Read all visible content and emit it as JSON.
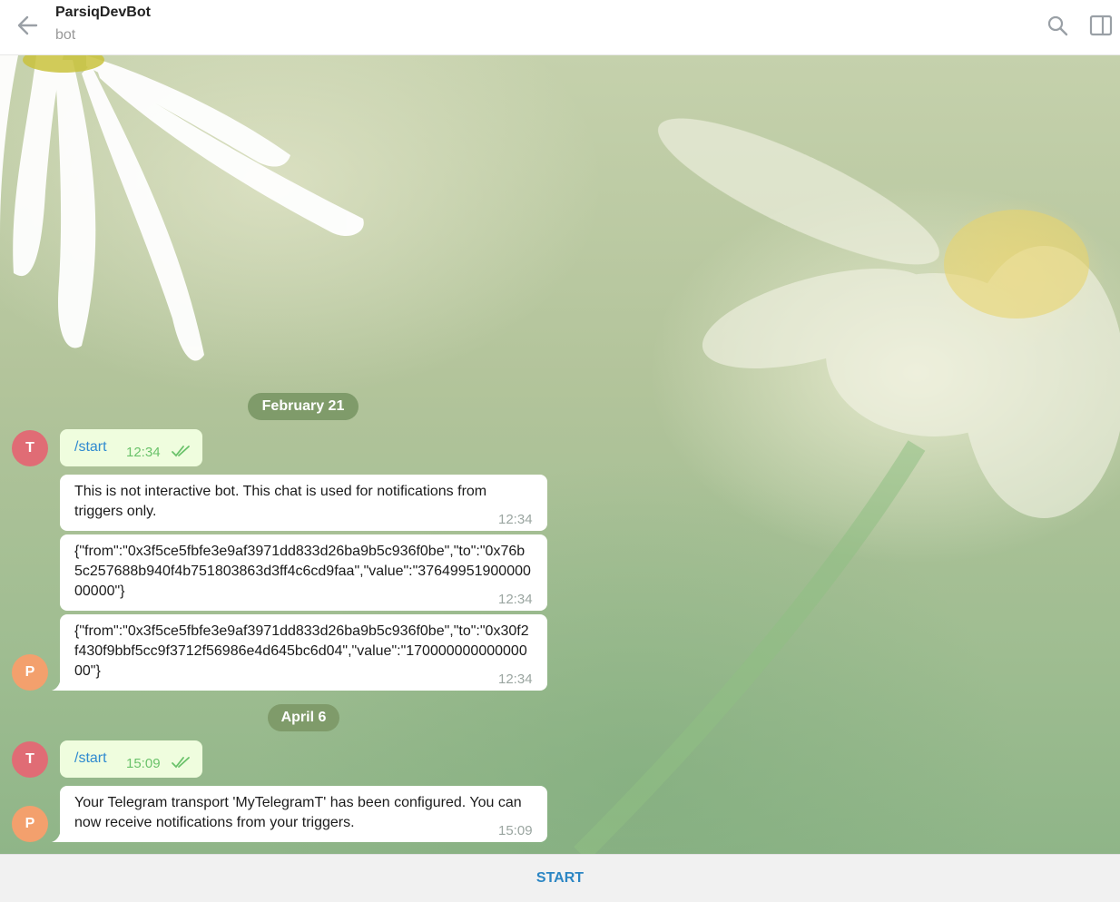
{
  "header": {
    "title": "ParsiqDevBot",
    "subtitle": "bot"
  },
  "chat": {
    "dates": [
      "February 21",
      "April 6"
    ],
    "avatars": {
      "user_initial": "T",
      "bot_initial": "P"
    },
    "messages": [
      {
        "text": "/start",
        "time": "12:34"
      },
      {
        "text": "This is not interactive bot. This chat is used for notifications from triggers only.",
        "time": "12:34"
      },
      {
        "text": "{\"from\":\"0x3f5ce5fbfe3e9af3971dd833d26ba9b5c936f0be\",\"to\":\"0x76b5c257688b940f4b751803863d3ff4c6cd9faa\",\"value\":\"3764995190000000000\"}",
        "time": "12:34"
      },
      {
        "text": "{\"from\":\"0x3f5ce5fbfe3e9af3971dd833d26ba9b5c936f0be\",\"to\":\"0x30f2f430f9bbf5cc9f3712f56986e4d645bc6d04\",\"value\":\"17000000000000000\"}",
        "time": "12:34"
      },
      {
        "text": "/start",
        "time": "15:09"
      },
      {
        "text": "Your Telegram transport 'MyTelegramT' has been configured. You can now receive notifications from your triggers.",
        "time": "15:09"
      }
    ]
  },
  "bottom": {
    "start_label": "START"
  },
  "colors": {
    "outgoing_bubble": "#effdde",
    "incoming_bubble": "#ffffff",
    "date_pill": "#7f9b6a",
    "accent": "#2b86c4",
    "avatar_user": "#e06c75",
    "avatar_bot": "#f3a06d"
  },
  "icons": [
    "back-arrow-icon",
    "search-icon",
    "side-panel-icon",
    "double-check-icon"
  ]
}
